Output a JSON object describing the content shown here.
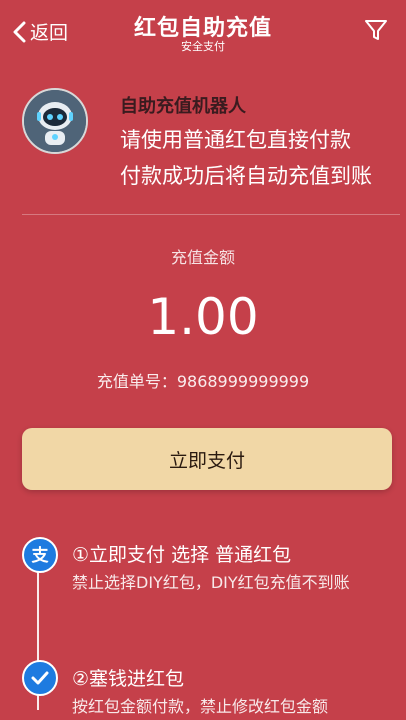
{
  "header": {
    "back_label": "返回",
    "title": "红包自助充值",
    "subtitle": "安全支付",
    "icons": {
      "back": "chevron-left-icon",
      "filter": "filter-icon"
    }
  },
  "robot": {
    "name": "自助充值机器人",
    "message_line1": "请使用普通红包直接付款",
    "message_line2": "付款成功后将自动充值到账"
  },
  "recharge": {
    "amount_label": "充值金额",
    "amount": "1.00",
    "order_label": "充值单号：",
    "order_number": "9868999999999"
  },
  "pay_button_label": "立即支付",
  "steps": [
    {
      "title": "①立即支付 选择 普通红包",
      "desc": "禁止选择DIY红包，DIY红包充值不到账",
      "icon": "alipay-icon"
    },
    {
      "title": "②塞钱进红包",
      "desc": "按红包金额付款，禁止修改红包金额",
      "icon": "check-circle-icon"
    }
  ],
  "colors": {
    "background": "#c5404a",
    "button": "#f1d7a6",
    "step_icon": "#1e7be0"
  }
}
